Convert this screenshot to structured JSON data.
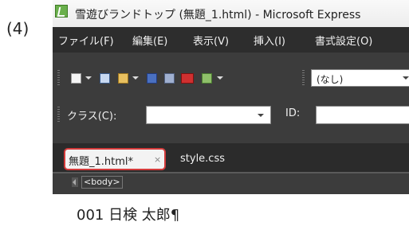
{
  "step_label": "(4)",
  "window": {
    "title": "雪遊びランドトップ (無題_1.html) - Microsoft Express"
  },
  "menu": [
    "ファイル(F)",
    "編集(E)",
    "表示(V)",
    "挿入(I)",
    "書式設定(O)"
  ],
  "toolbar": {
    "style_select": "(なし)",
    "icons": [
      "new-file-icon",
      "document-icon",
      "open-folder-icon",
      "save-icon",
      "publish-icon",
      "sp-icon",
      "preview-icon"
    ]
  },
  "toolbar2": {
    "class_label": "クラス(C):",
    "id_label": "ID:"
  },
  "tabs": [
    {
      "label": "無題_1.html*",
      "close": "×",
      "active": true
    },
    {
      "label": "style.css",
      "active": false
    }
  ],
  "breadcrumb": {
    "tag": "<body>"
  },
  "editor": {
    "first_line": "001 日検 太郎¶"
  },
  "colors": {
    "highlight_border": "#d43b3b",
    "dark_bg": "#3c3c3c"
  }
}
